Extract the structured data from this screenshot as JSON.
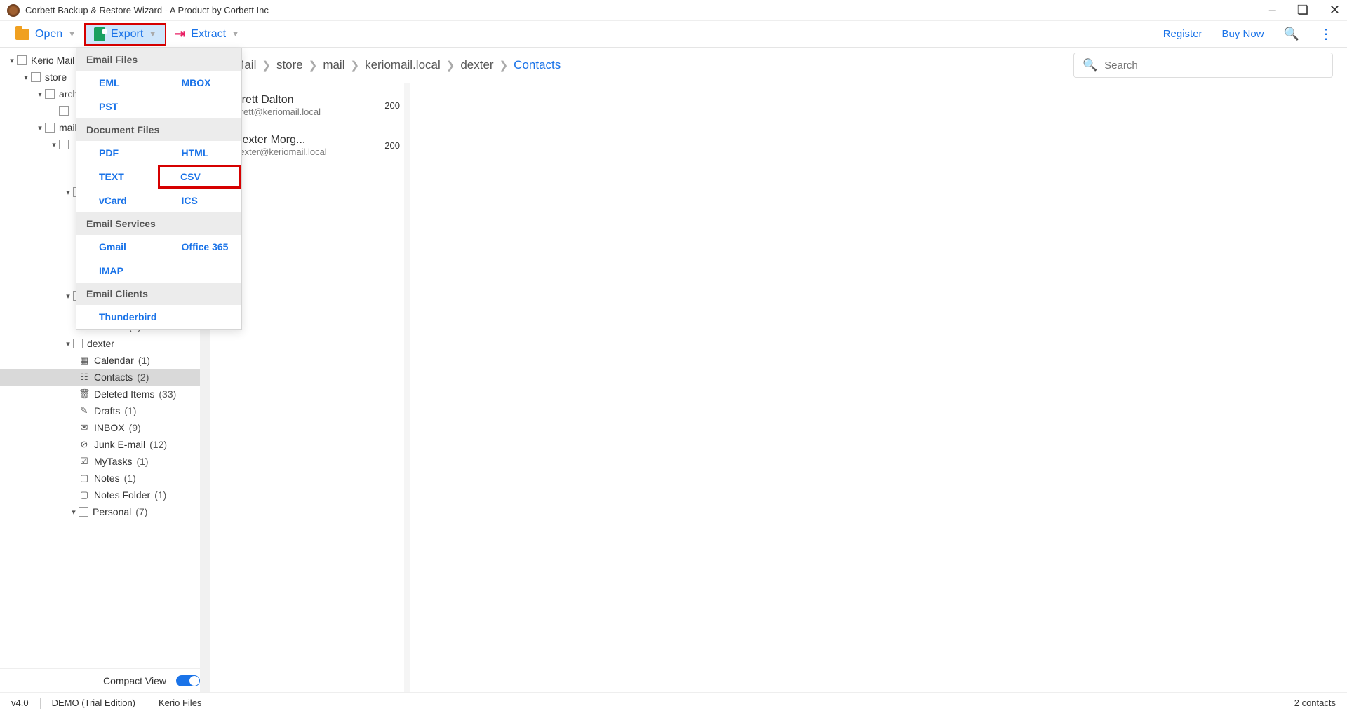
{
  "titlebar": {
    "title": "Corbett Backup & Restore Wizard - A Product by Corbett Inc"
  },
  "toolbar": {
    "open": "Open",
    "export": "Export",
    "extract": "Extract",
    "register": "Register",
    "buynow": "Buy Now"
  },
  "export_menu": {
    "h1": "Email Files",
    "eml": "EML",
    "mbox": "MBOX",
    "pst": "PST",
    "h2": "Document Files",
    "pdf": "PDF",
    "html": "HTML",
    "text": "TEXT",
    "csv": "CSV",
    "vcard": "vCard",
    "ics": "ICS",
    "h3": "Email Services",
    "gmail": "Gmail",
    "o365": "Office 365",
    "imap": "IMAP",
    "h4": "Email Clients",
    "tb": "Thunderbird"
  },
  "tree": {
    "kerio": "Kerio Mail",
    "store": "store",
    "arch": "arch",
    "mail": "mail",
    "inbox1": "INBOX",
    "inbox1c": "(4)",
    "dexter": "dexter",
    "cal": "Calendar",
    "calc": "(1)",
    "contacts": "Contacts",
    "contactsc": "(2)",
    "deleted": "Deleted Items",
    "deletedc": "(33)",
    "drafts": "Drafts",
    "draftsc": "(1)",
    "inbox2": "INBOX",
    "inbox2c": "(9)",
    "junk": "Junk E-mail",
    "junkc": "(12)",
    "mytasks": "MyTasks",
    "mytasksc": "(1)",
    "notes": "Notes",
    "notesc": "(1)",
    "notesf": "Notes Folder",
    "notesfc": "(1)",
    "personal": "Personal",
    "personalc": "(7)"
  },
  "compact": "Compact View",
  "breadcrumb": {
    "c0": "o Mail",
    "c1": "store",
    "c2": "mail",
    "c3": "keriomail.local",
    "c4": "dexter",
    "c5": "Contacts"
  },
  "search_placeholder": "Search",
  "contacts": [
    {
      "name": "Brett Dalton",
      "email": "Brett@keriomail.local",
      "size": "200",
      "color": "#b01020"
    },
    {
      "name": "Dexter Morg...",
      "email": "dexter@keriomail.local",
      "size": "200",
      "color": "#2a8a3a"
    }
  ],
  "status": {
    "ver": "v4.0",
    "edition": "DEMO (Trial Edition)",
    "src": "Kerio Files",
    "count": "2  contacts"
  }
}
